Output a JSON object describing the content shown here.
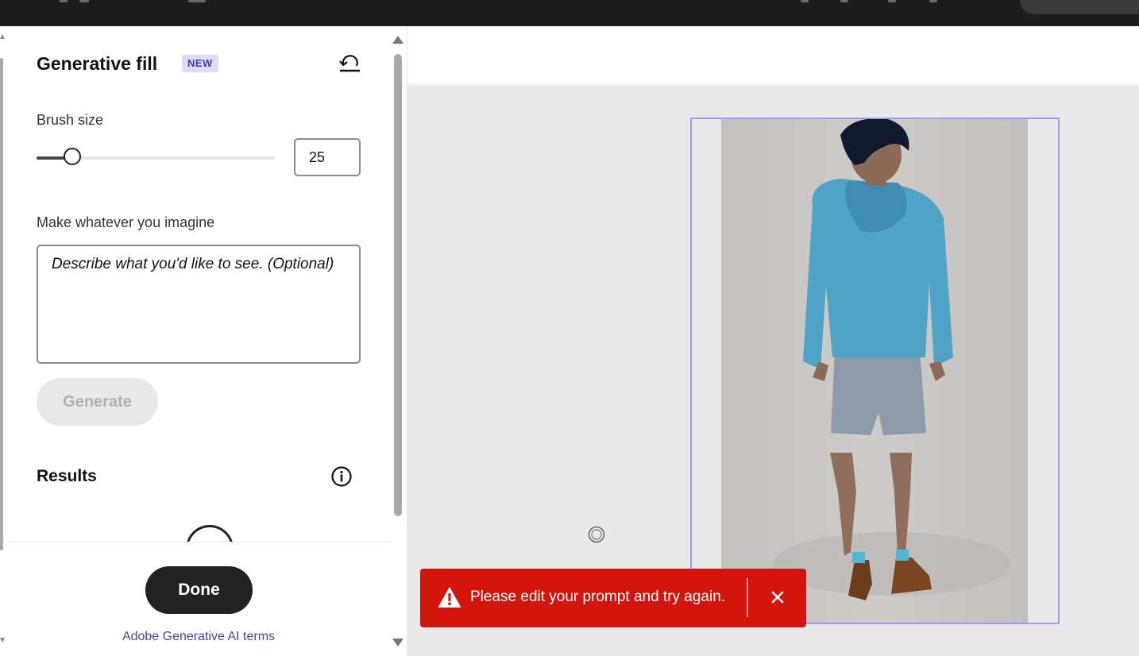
{
  "panel": {
    "title": "Generative fill",
    "badge": "NEW",
    "reset_icon": "undo-reset-icon",
    "brush": {
      "label": "Brush size",
      "value": "25",
      "slider_fraction": 0.15
    },
    "prompt": {
      "label": "Make whatever you imagine",
      "placeholder": "Describe what you'd like to see. (Optional)",
      "value": ""
    },
    "generate_label": "Generate",
    "results_label": "Results",
    "info_icon": "info-icon",
    "done_label": "Done",
    "terms_link": "Adobe Generative AI terms"
  },
  "toast": {
    "icon": "warning-icon",
    "message": "Please edit your prompt and try again.",
    "close_icon": "close-icon"
  },
  "colors": {
    "accent": "#3b3fa8",
    "badge_bg": "#dcdcf7",
    "selection": "#9b9bf5",
    "error": "#d2150f",
    "hoodie": "#4fa3c7"
  }
}
